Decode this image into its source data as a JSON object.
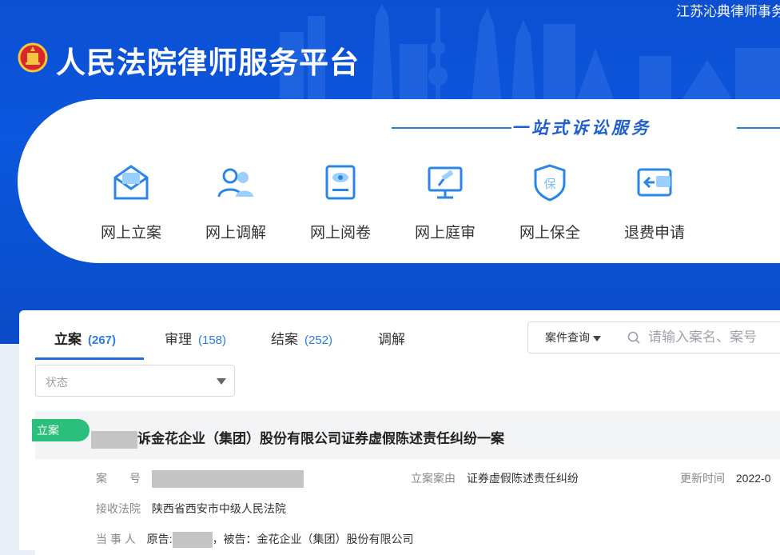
{
  "header": {
    "firm_name": "江苏沁典律师事务",
    "platform_title": "人民法院律师服务平台",
    "slogan": "一站式诉讼服务"
  },
  "services": [
    {
      "label": "网上立案",
      "icon": "envelope-icon"
    },
    {
      "label": "网上调解",
      "icon": "users-icon"
    },
    {
      "label": "网上阅卷",
      "icon": "file-view-icon"
    },
    {
      "label": "网上庭审",
      "icon": "courtroom-gavel-icon"
    },
    {
      "label": "网上保全",
      "icon": "shield-bao-icon"
    },
    {
      "label": "退费申请",
      "icon": "wallet-refund-icon"
    }
  ],
  "tabs": [
    {
      "label": "立案",
      "count": "(267)",
      "active": true
    },
    {
      "label": "审理",
      "count": "(158)",
      "active": false
    },
    {
      "label": "结案",
      "count": "(252)",
      "active": false
    },
    {
      "label": "调解",
      "count": "",
      "active": false
    }
  ],
  "filter": {
    "status_placeholder": "状态",
    "query_button": "案件查询",
    "search_placeholder": "请输入案名、案号"
  },
  "case": {
    "tag": "立案",
    "title": "诉金花企业（集团）股份有限公司证券虚假陈述责任纠纷一案",
    "case_no_label": "案　　号",
    "cause_label": "立案案由",
    "cause_value": "证券虚假陈述责任纠纷",
    "updated_label": "更新时间",
    "updated_value": "2022-0",
    "court_label": "接收法院",
    "court_value": "陕西省西安市中级人民法院",
    "parties_label": "当 事 人",
    "plaintiff_prefix": "原告:",
    "defendant_text": "，被告：金花企业（集团）股份有限公司"
  },
  "colors": {
    "hero_blue": "#0b57dd",
    "accent_blue": "#1d6fe0",
    "tag_green": "#2bbf7c",
    "redaction_gray": "#c4c4c4"
  }
}
